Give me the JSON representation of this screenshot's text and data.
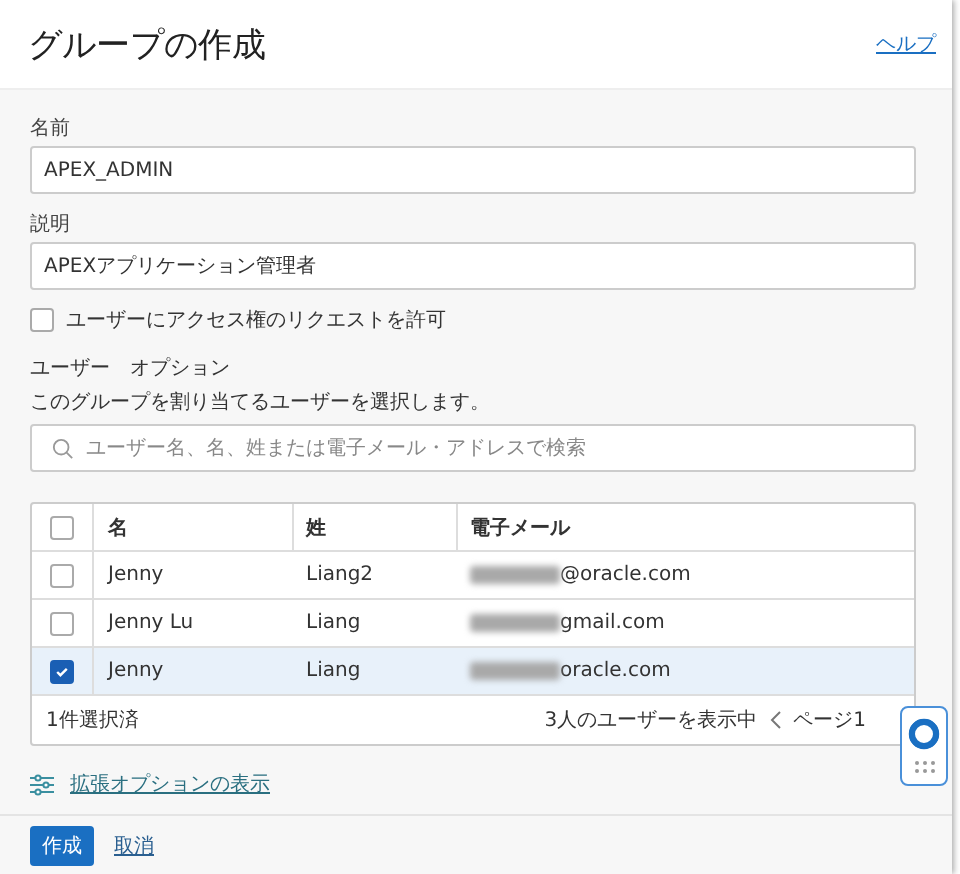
{
  "header": {
    "title": "グループの作成",
    "help_link": "ヘルプ"
  },
  "fields": [
    {
      "label": "名前",
      "value": "APEX_ADMIN"
    },
    {
      "label": "説明",
      "value": "APEXアプリケーション管理者"
    }
  ],
  "request_access": {
    "label": "ユーザーにアクセス権のリクエストを許可",
    "checked": false
  },
  "user_options": {
    "heading": "ユーザー　オプション",
    "description": "このグループを割り当てるユーザーを選択します。"
  },
  "search": {
    "placeholder": "ユーザー名、名、姓または電子メール・アドレスで検索"
  },
  "table": {
    "select_all": false,
    "columns": [
      "名",
      "姓",
      "電子メール"
    ],
    "rows": [
      {
        "first": "Jenny",
        "last": "Liang2",
        "email": "@oracle.com",
        "selected": false
      },
      {
        "first": "Jenny Lu",
        "last": "Liang",
        "email": "gmail.com",
        "selected": false
      },
      {
        "first": "Jenny",
        "last": "Liang",
        "email": "oracle.com",
        "selected": true
      }
    ],
    "footer": {
      "selection": "1件選択済",
      "count": "3人のユーザーを表示中",
      "page": "ページ1"
    }
  },
  "advanced_link": "拡張オプションの表示",
  "buttons": {
    "create": "作成",
    "cancel": "取消"
  }
}
